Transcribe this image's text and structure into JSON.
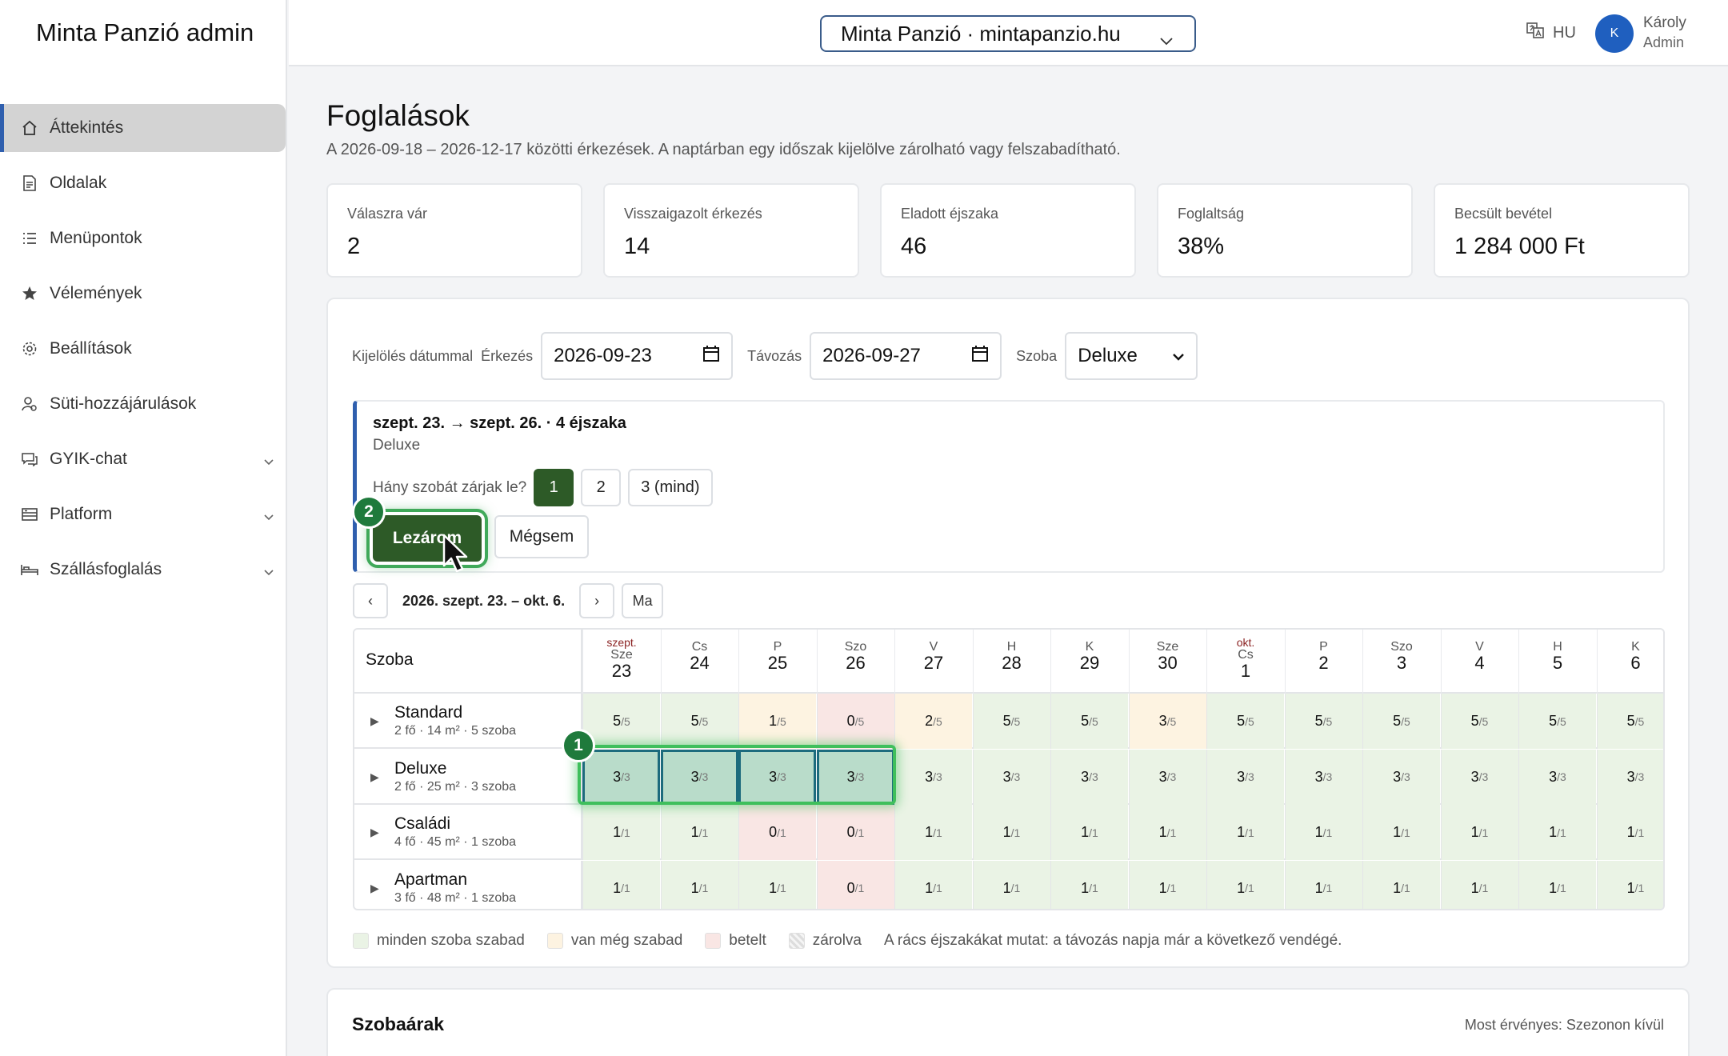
{
  "app": {
    "title": "Minta Panzió admin"
  },
  "sidebar": {
    "items": [
      {
        "label": "Áttekintés",
        "icon": "home-icon",
        "active": true
      },
      {
        "label": "Oldalak",
        "icon": "document-icon"
      },
      {
        "label": "Menüpontok",
        "icon": "list-icon"
      },
      {
        "label": "Vélemények",
        "icon": "star-icon"
      },
      {
        "label": "Beállítások",
        "icon": "gear-icon"
      },
      {
        "label": "Süti-hozzájárulások",
        "icon": "user-cookie-icon"
      },
      {
        "label": "GYIK-chat",
        "icon": "chat-icon",
        "expandable": true
      },
      {
        "label": "Platform",
        "icon": "server-icon",
        "expandable": true
      },
      {
        "label": "Szállásfoglalás",
        "icon": "bed-icon",
        "expandable": true
      }
    ]
  },
  "topbar": {
    "site": "Minta Panzió · mintapanzio.hu",
    "lang": "HU",
    "avatar_initial": "K",
    "user_name": "Károly",
    "user_role": "Admin"
  },
  "main": {
    "title": "Foglalások",
    "subtitle": "A 2026-09-18 – 2026-12-17 közötti érkezések. A naptárban egy időszak kijelölve zárolható vagy felszabadítható.",
    "stats": [
      {
        "label": "Válaszra vár",
        "value": "2"
      },
      {
        "label": "Visszaigazolt érkezés",
        "value": "14"
      },
      {
        "label": "Eladott éjszaka",
        "value": "46"
      },
      {
        "label": "Foglaltság",
        "value": "38%"
      },
      {
        "label": "Becsült bevétel",
        "value": "1 284 000 Ft"
      }
    ]
  },
  "filter": {
    "label": "Kijelölés dátummal",
    "arrival_label": "Érkezés",
    "arrival_value": "2026-09-23",
    "departure_label": "Távozás",
    "departure_value": "2026-09-27",
    "room_label": "Szoba",
    "room_value": "Deluxe"
  },
  "selection": {
    "title": "szept. 23. → szept. 26. · 4 éjszaka",
    "room": "Deluxe",
    "count_label": "Hány szobát zárjak le?",
    "options": [
      "1",
      "2",
      "3 (mind)"
    ],
    "selected_option": "1",
    "lock_button": "Lezárom",
    "cancel_button": "Mégsem",
    "badge_1": "1",
    "badge_2": "2"
  },
  "pager": {
    "prev": "‹",
    "range": "2026. szept. 23. – okt. 6.",
    "next": "›",
    "today": "Ma"
  },
  "grid": {
    "room_header": "Szoba",
    "days": [
      {
        "month": "szept.",
        "dow": "Sze",
        "day": "23"
      },
      {
        "month": "",
        "dow": "Cs",
        "day": "24"
      },
      {
        "month": "",
        "dow": "P",
        "day": "25"
      },
      {
        "month": "",
        "dow": "Szo",
        "day": "26"
      },
      {
        "month": "",
        "dow": "V",
        "day": "27"
      },
      {
        "month": "",
        "dow": "H",
        "day": "28"
      },
      {
        "month": "",
        "dow": "K",
        "day": "29"
      },
      {
        "month": "",
        "dow": "Sze",
        "day": "30"
      },
      {
        "month": "okt.",
        "dow": "Cs",
        "day": "1"
      },
      {
        "month": "",
        "dow": "P",
        "day": "2"
      },
      {
        "month": "",
        "dow": "Szo",
        "day": "3"
      },
      {
        "month": "",
        "dow": "V",
        "day": "4"
      },
      {
        "month": "",
        "dow": "H",
        "day": "5"
      },
      {
        "month": "",
        "dow": "K",
        "day": "6"
      }
    ],
    "rooms": [
      {
        "name": "Standard",
        "desc": "2 fő · 14 m² · 5 szoba",
        "total": "5",
        "avail": [
          "5",
          "5",
          "1",
          "0",
          "2",
          "5",
          "5",
          "3",
          "5",
          "5",
          "5",
          "5",
          "5",
          "5"
        ],
        "state": [
          "free",
          "free",
          "part",
          "full",
          "part",
          "free",
          "free",
          "part",
          "free",
          "free",
          "free",
          "free",
          "free",
          "free"
        ]
      },
      {
        "name": "Deluxe",
        "desc": "2 fő · 25 m² · 3 szoba",
        "total": "3",
        "avail": [
          "3",
          "3",
          "3",
          "3",
          "3",
          "3",
          "3",
          "3",
          "3",
          "3",
          "3",
          "3",
          "3",
          "3"
        ],
        "state": [
          "sel",
          "sel",
          "sel",
          "sel",
          "free",
          "free",
          "free",
          "free",
          "free",
          "free",
          "free",
          "free",
          "free",
          "free"
        ]
      },
      {
        "name": "Családi",
        "desc": "4 fő · 45 m² · 1 szoba",
        "total": "1",
        "avail": [
          "1",
          "1",
          "0",
          "0",
          "1",
          "1",
          "1",
          "1",
          "1",
          "1",
          "1",
          "1",
          "1",
          "1"
        ],
        "state": [
          "free",
          "free",
          "full",
          "full",
          "free",
          "free",
          "free",
          "free",
          "free",
          "free",
          "free",
          "free",
          "free",
          "free"
        ]
      },
      {
        "name": "Apartman",
        "desc": "3 fő · 48 m² · 1 szoba",
        "total": "1",
        "avail": [
          "1",
          "1",
          "1",
          "0",
          "1",
          "1",
          "1",
          "1",
          "1",
          "1",
          "1",
          "1",
          "1",
          "1"
        ],
        "state": [
          "free",
          "free",
          "free",
          "full",
          "free",
          "free",
          "free",
          "free",
          "free",
          "free",
          "free",
          "free",
          "free",
          "free"
        ]
      }
    ]
  },
  "legend": {
    "free": "minden szoba szabad",
    "part": "van még szabad",
    "full": "betelt",
    "locked": "zárolva",
    "note": "A rács éjszakákat mutat: a távozás napja már a következő vendégé."
  },
  "prices": {
    "title": "Szobaárak",
    "current": "Most érvényes: Szezonon kívül"
  },
  "colors": {
    "accent": "#2f5fae",
    "primary_green": "#2d5a27",
    "free": "#eaf3e5",
    "part": "#fdf3e1",
    "full": "#f9e6e4"
  }
}
